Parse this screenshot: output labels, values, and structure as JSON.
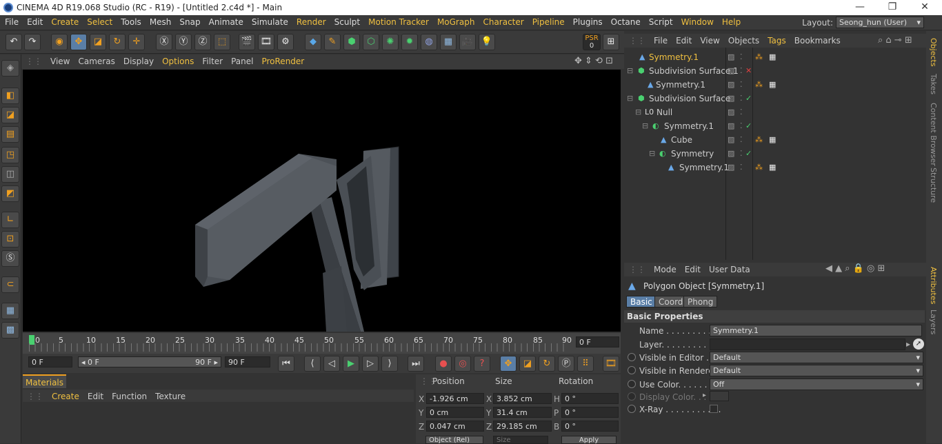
{
  "window": {
    "title": "CINEMA 4D R19.068 Studio (RC - R19) - [Untitled 2.c4d *] - Main"
  },
  "menubar": {
    "items": [
      "File",
      "Edit",
      "Create",
      "Select",
      "Tools",
      "Mesh",
      "Snap",
      "Animate",
      "Simulate",
      "Render",
      "Sculpt",
      "Motion Tracker",
      "MoGraph",
      "Character",
      "Pipeline",
      "Plugins",
      "Octane",
      "Script",
      "Window",
      "Help"
    ],
    "layout_label": "Layout:",
    "layout_value": "Seong_hun (User)"
  },
  "toolbar": {
    "psr_label": "PSR",
    "psr_value": "0"
  },
  "viewport_menu": {
    "items": [
      "View",
      "Cameras",
      "Display",
      "Options",
      "Filter",
      "Panel",
      "ProRender"
    ]
  },
  "timeline": {
    "ticks": [
      "0",
      "5",
      "10",
      "15",
      "20",
      "25",
      "30",
      "35",
      "40",
      "45",
      "50",
      "55",
      "60",
      "65",
      "70",
      "75",
      "80",
      "85",
      "90"
    ],
    "end_frame": "0 F",
    "start_field": "0 F",
    "range_start": "◂ 0 F",
    "range_end": "90 F ▸",
    "max_field": "90 F"
  },
  "materials": {
    "tab": "Materials",
    "menu": [
      "Create",
      "Edit",
      "Function",
      "Texture"
    ]
  },
  "coords": {
    "headers": [
      "Position",
      "Size",
      "Rotation"
    ],
    "rows": [
      {
        "axis": "X",
        "pos": "-1.926 cm",
        "size_axis": "X",
        "size": "3.852 cm",
        "rot_axis": "H",
        "rot": "0 °"
      },
      {
        "axis": "Y",
        "pos": "0 cm",
        "size_axis": "Y",
        "size": "31.4 cm",
        "rot_axis": "P",
        "rot": "0 °"
      },
      {
        "axis": "Z",
        "pos": "0.047 cm",
        "size_axis": "Z",
        "size": "29.185 cm",
        "rot_axis": "B",
        "rot": "0 °"
      }
    ],
    "mode": "Object (Rel)",
    "size_mode": "Size",
    "apply": "Apply"
  },
  "objects": {
    "menu": [
      "File",
      "Edit",
      "View",
      "Objects",
      "Tags",
      "Bookmarks"
    ],
    "rows": [
      {
        "name": "Symmetry.1",
        "indent": 0,
        "selected": true
      },
      {
        "name": "Subdivision Surface.1",
        "indent": 0,
        "selected": false
      },
      {
        "name": "Symmetry.1",
        "indent": 1,
        "selected": false
      },
      {
        "name": "Subdivision Surface",
        "indent": 0,
        "selected": false
      },
      {
        "name": "Null",
        "indent": 1,
        "selected": false
      },
      {
        "name": "Symmetry.1",
        "indent": 2,
        "selected": false
      },
      {
        "name": "Cube",
        "indent": 3,
        "selected": false
      },
      {
        "name": "Symmetry",
        "indent": 3,
        "selected": false
      },
      {
        "name": "Symmetry.1",
        "indent": 4,
        "selected": false
      }
    ]
  },
  "side_tabs": [
    "Objects",
    "Takes",
    "Content Browser",
    "Structure",
    "Attributes",
    "Layers"
  ],
  "attributes": {
    "menu": [
      "Mode",
      "Edit",
      "User Data"
    ],
    "object_title": "Polygon Object [Symmetry.1]",
    "tabs": [
      "Basic",
      "Coord.",
      "Phong"
    ],
    "section": "Basic Properties",
    "fields": [
      {
        "label": "Name . . . . . . . . . . .",
        "value": "Symmetry.1"
      },
      {
        "label": "Layer. . . . . . . . . . . .",
        "value": ""
      },
      {
        "label": "Visible in Editor . .",
        "value": "Default"
      },
      {
        "label": "Visible in Renderer",
        "value": "Default"
      },
      {
        "label": "Use Color. . . . . . . .",
        "value": "Off"
      },
      {
        "label": "Display Color. . . .",
        "value": ""
      },
      {
        "label": "X-Ray . . . . . . . . . . .",
        "value": ""
      }
    ]
  }
}
